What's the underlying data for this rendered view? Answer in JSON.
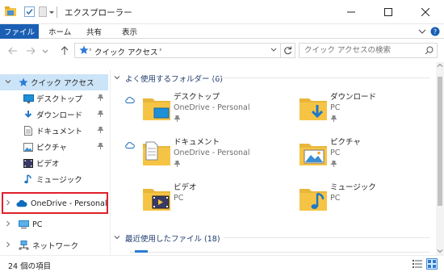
{
  "window": {
    "title": "エクスプローラー"
  },
  "ribbon": {
    "tabs": [
      "ファイル",
      "ホーム",
      "共有",
      "表示"
    ]
  },
  "address": {
    "path": "クイック アクセス",
    "search_placeholder": "クイック アクセスの検索"
  },
  "nav": {
    "items": [
      {
        "label": "クイック アクセス",
        "icon": "star-icon",
        "pinned": false
      },
      {
        "label": "デスクトップ",
        "icon": "desktop-icon",
        "pinned": true
      },
      {
        "label": "ダウンロード",
        "icon": "download-icon",
        "pinned": true
      },
      {
        "label": "ドキュメント",
        "icon": "document-icon",
        "pinned": true
      },
      {
        "label": "ピクチャ",
        "icon": "picture-icon",
        "pinned": true
      },
      {
        "label": "ビデオ",
        "icon": "video-icon",
        "pinned": false
      },
      {
        "label": "ミュージック",
        "icon": "music-icon",
        "pinned": false
      },
      {
        "label": "OneDrive - Personal",
        "icon": "onedrive-icon",
        "pinned": false
      },
      {
        "label": "PC",
        "icon": "pc-icon",
        "pinned": false
      },
      {
        "label": "ネットワーク",
        "icon": "network-icon",
        "pinned": false
      }
    ]
  },
  "frequent": {
    "header": "よく使用するフォルダー (6)",
    "folders": [
      {
        "name": "デスクトップ",
        "location": "OneDrive - Personal",
        "pinned": true,
        "cloud": true
      },
      {
        "name": "ダウンロード",
        "location": "PC",
        "pinned": true,
        "cloud": false
      },
      {
        "name": "ドキュメント",
        "location": "OneDrive - Personal",
        "pinned": true,
        "cloud": true
      },
      {
        "name": "ピクチャ",
        "location": "PC",
        "pinned": true,
        "cloud": false
      },
      {
        "name": "ビデオ",
        "location": "PC",
        "pinned": false,
        "cloud": false
      },
      {
        "name": "ミュージック",
        "location": "PC",
        "pinned": false,
        "cloud": false
      }
    ]
  },
  "recent": {
    "header": "最近使用したファイル (18)"
  },
  "status": {
    "count": "24 個の項目"
  },
  "colors": {
    "accent": "#1a5fb4",
    "selection": "#cce4f7",
    "folder": "#f6c445",
    "highlight": "#e0202a"
  }
}
